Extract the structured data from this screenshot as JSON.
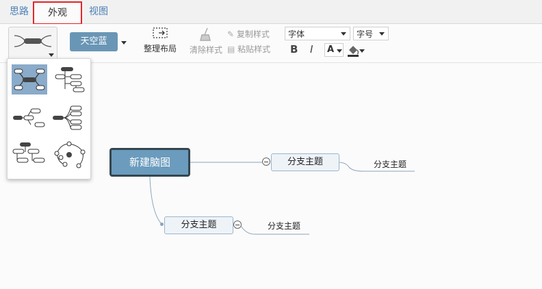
{
  "tabs": [
    {
      "label": "思路",
      "active": false
    },
    {
      "label": "外观",
      "active": true
    },
    {
      "label": "视图",
      "active": false
    }
  ],
  "toolbar": {
    "theme_label": "天空蓝",
    "arrange_label": "整理布局",
    "clear_style_label": "清除样式",
    "copy_style_label": "复制样式",
    "paste_style_label": "粘贴样式",
    "font_select_value": "字体",
    "size_select_value": "字号",
    "bold_label": "B",
    "italic_label": "I",
    "font_color_label": "A"
  },
  "layout_menu": {
    "options": [
      "mind-map-layout",
      "org-chart-layout",
      "logical-structure-layout",
      "right-logic-layout",
      "tree-structure-layout",
      "fishbone-layout"
    ],
    "selected_index": 0
  },
  "mindmap": {
    "root": "新建脑图",
    "branches": [
      {
        "label": "分支主题",
        "child": "分支主题"
      },
      {
        "label": "分支主题",
        "child": "分支主题"
      }
    ]
  },
  "colors": {
    "accent": "#6b9bbd",
    "tab_highlight": "#e0262b",
    "link": "#4a7fb5"
  }
}
